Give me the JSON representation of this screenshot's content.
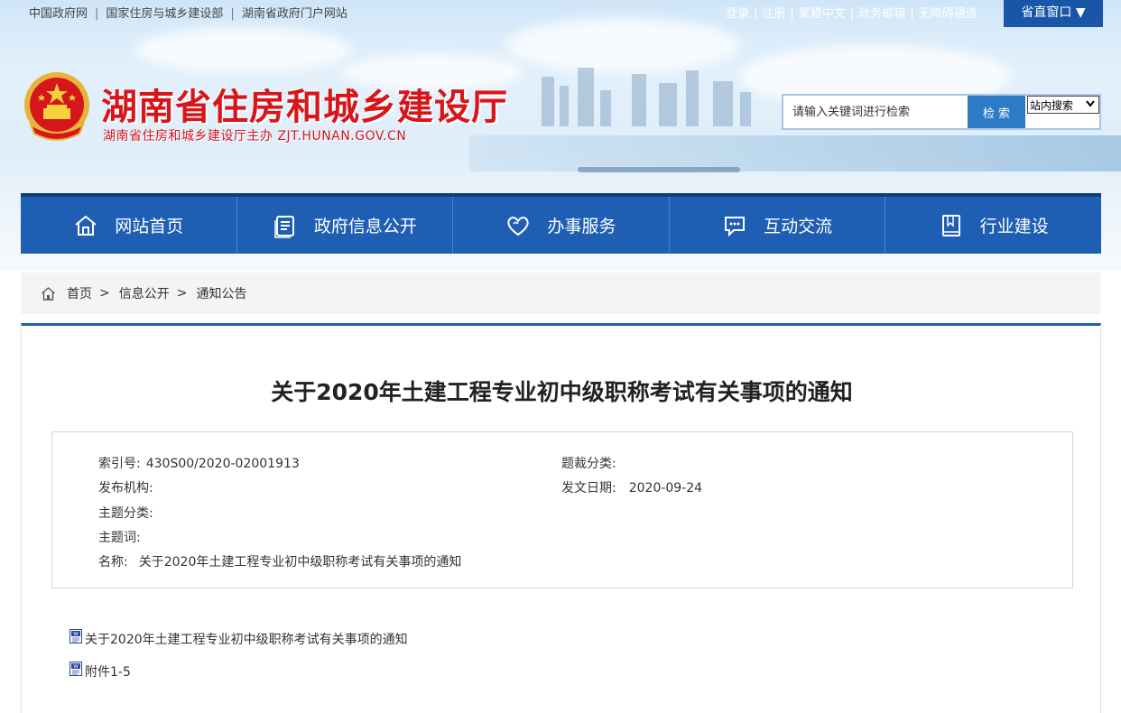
{
  "topbar": {
    "left_links": [
      "中国政府网",
      "国家住房与城乡建设部",
      "湖南省政府门户网站"
    ],
    "right_links": [
      "登录",
      "注册",
      "繁體中文",
      "政务邮箱",
      "无障碍通道"
    ],
    "province_window": "省直窗口 ▼"
  },
  "header": {
    "title": "湖南省住房和城乡建设厅",
    "subtitle": "湖南省住房和城乡建设厅主办  ZJT.HUNAN.GOV.CN"
  },
  "search": {
    "placeholder": "请输入关键词进行检索",
    "button": "检 索",
    "scope": "站内搜索"
  },
  "nav": [
    {
      "label": "网站首页",
      "icon": "home-icon"
    },
    {
      "label": "政府信息公开",
      "icon": "document-icon"
    },
    {
      "label": "办事服务",
      "icon": "heart-icon"
    },
    {
      "label": "互动交流",
      "icon": "chat-icon"
    },
    {
      "label": "行业建设",
      "icon": "book-icon"
    }
  ],
  "breadcrumb": [
    "首页",
    "信息公开",
    "通知公告"
  ],
  "article": {
    "title": "关于2020年土建工程专业初中级职称考试有关事项的通知",
    "meta": {
      "index_label": "索引号:",
      "index_value": "430S00/2020-02001913",
      "category_label": "题裁分类:",
      "category_value": "",
      "publisher_label": "发布机构:",
      "publisher_value": "",
      "date_label": "发文日期:",
      "date_value": "2020-09-24",
      "topic_label": "主题分类:",
      "topic_value": "",
      "keyword_label": "主题词:",
      "keyword_value": "",
      "name_label": "名称:",
      "name_value": "关于2020年土建工程专业初中级职称考试有关事项的通知"
    },
    "attachments": [
      "关于2020年土建工程专业初中级职称考试有关事项的通知",
      "附件1-5"
    ]
  },
  "colors": {
    "nav_blue": "#1f5fb3",
    "title_red": "#d7161c",
    "search_blue": "#2d7ac7"
  }
}
